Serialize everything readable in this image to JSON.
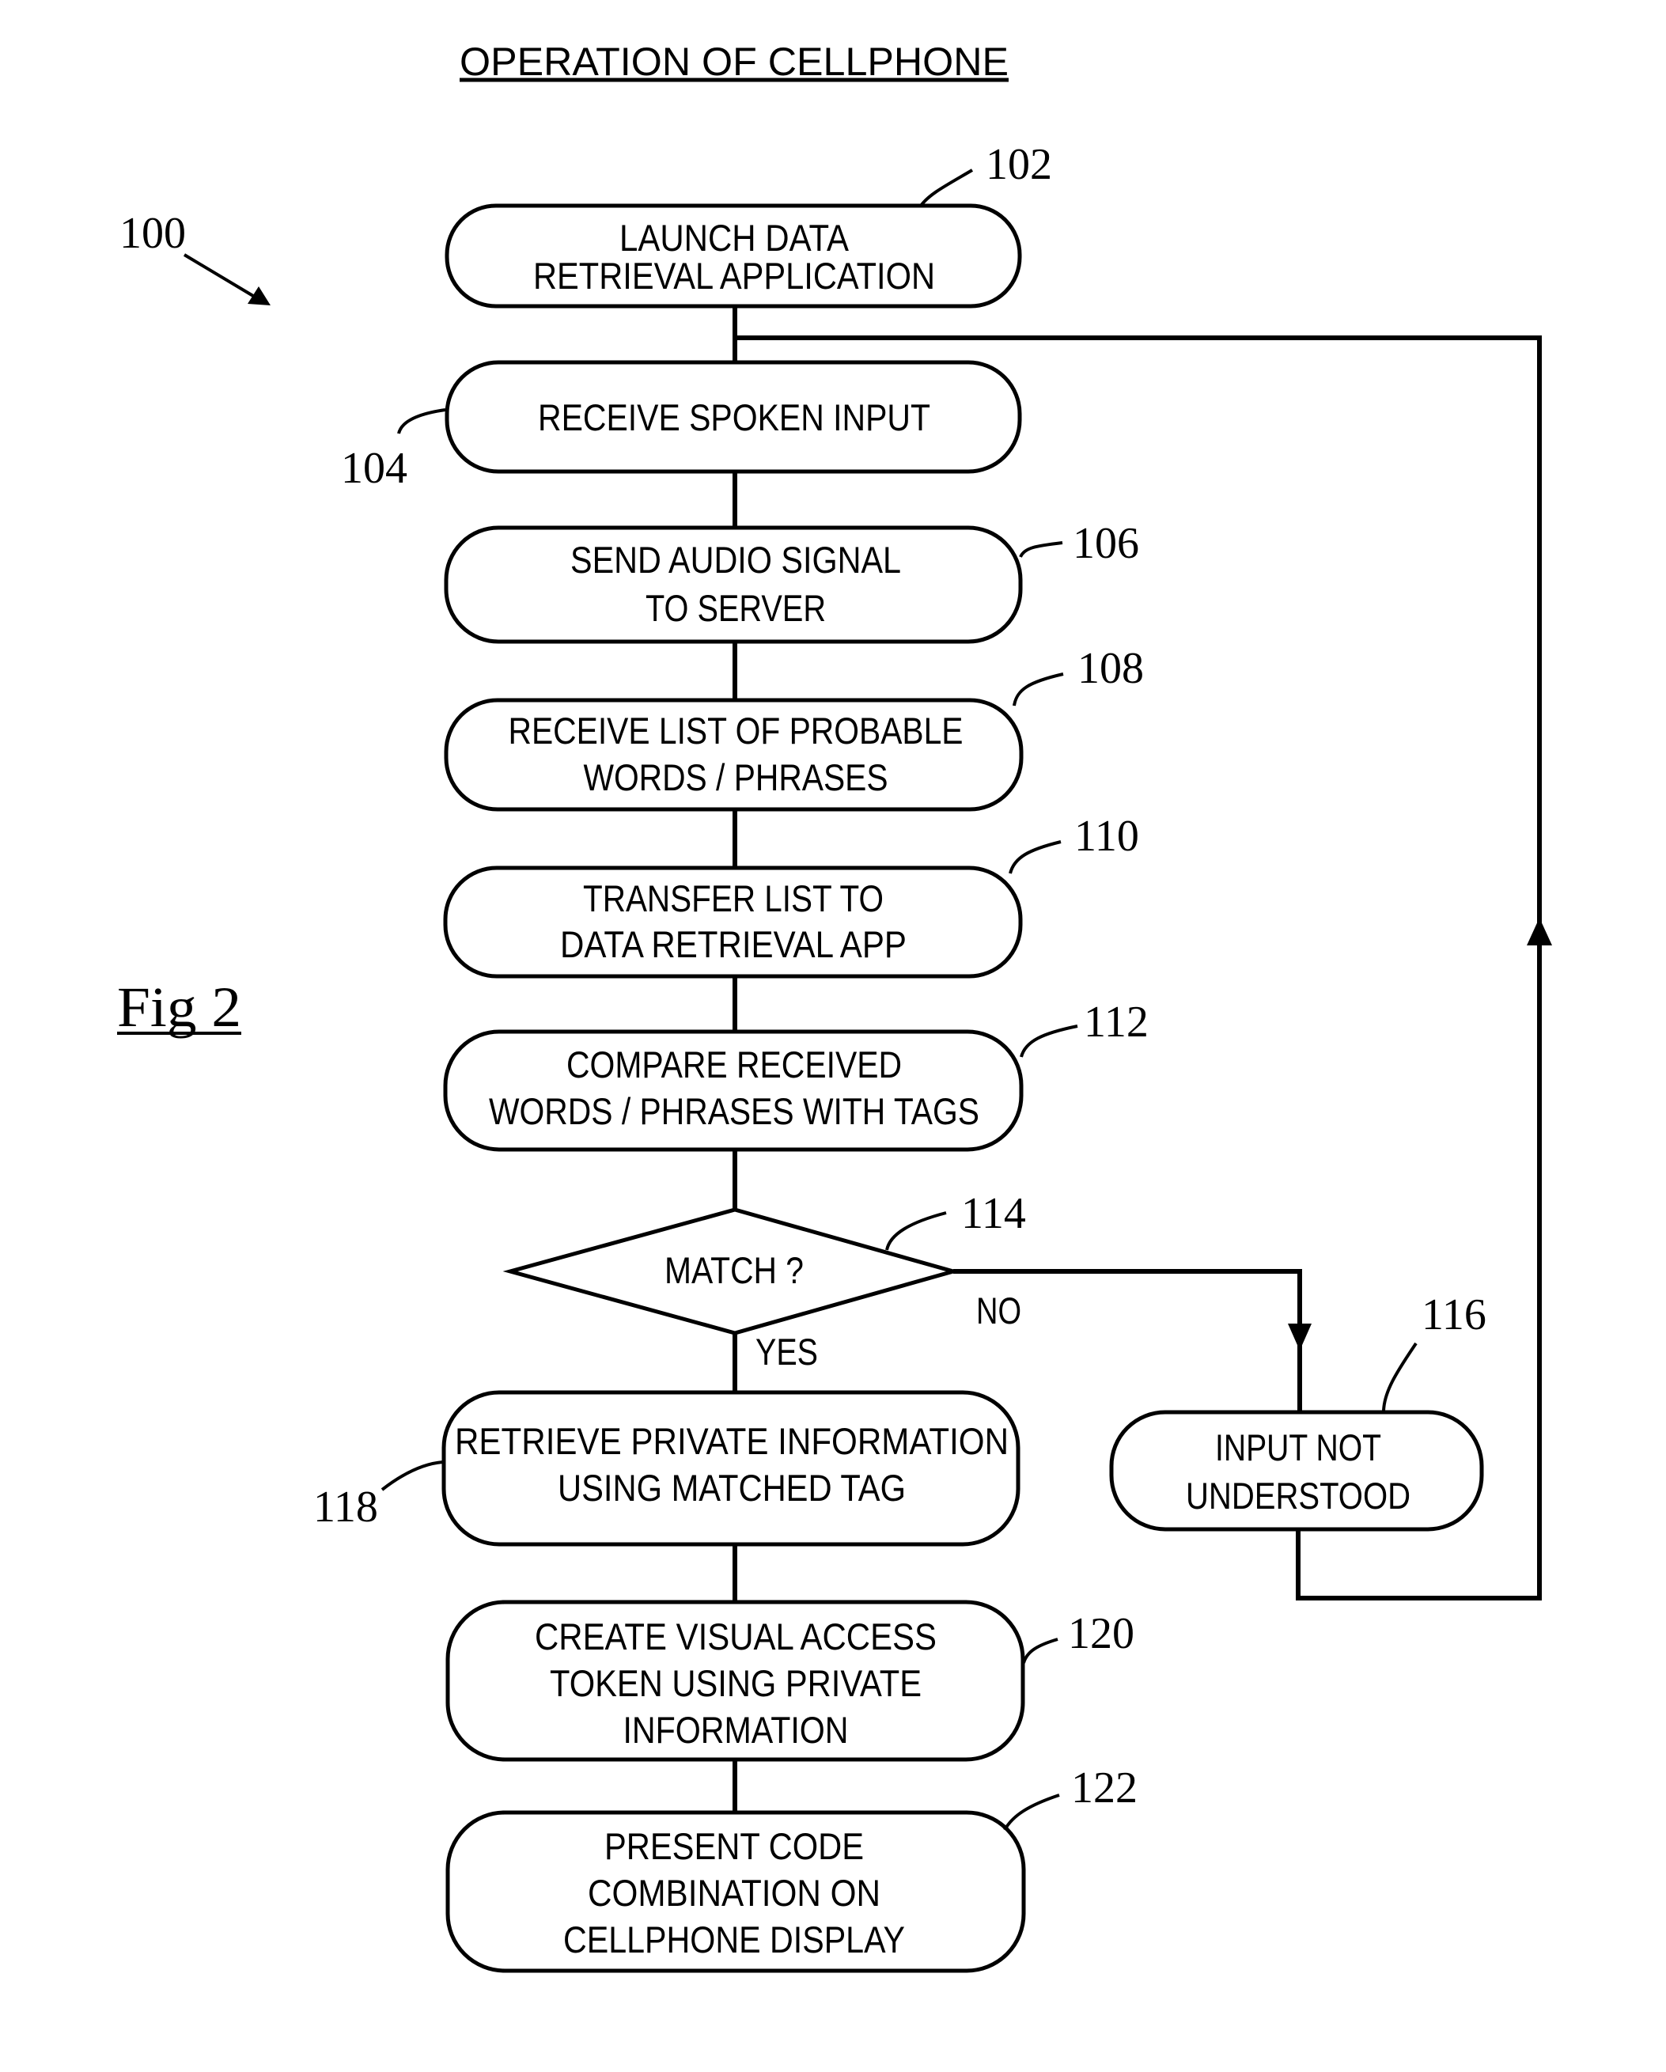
{
  "title": "OPERATION OF CELLPHONE",
  "figure_label": "Fig 2",
  "diagram_ref": "100",
  "steps": [
    {
      "id": "102",
      "type": "process",
      "lines": [
        "LAUNCH DATA",
        "RETRIEVAL APPLICATION"
      ]
    },
    {
      "id": "104",
      "type": "process",
      "lines": [
        "RECEIVE SPOKEN INPUT"
      ]
    },
    {
      "id": "106",
      "type": "process",
      "lines": [
        "SEND AUDIO SIGNAL",
        "TO SERVER"
      ]
    },
    {
      "id": "108",
      "type": "process",
      "lines": [
        "RECEIVE LIST OF PROBABLE",
        "WORDS / PHRASES"
      ]
    },
    {
      "id": "110",
      "type": "process",
      "lines": [
        "TRANSFER LIST TO",
        "DATA RETRIEVAL APP"
      ]
    },
    {
      "id": "112",
      "type": "process",
      "lines": [
        "COMPARE RECEIVED",
        "WORDS / PHRASES WITH TAGS"
      ]
    },
    {
      "id": "114",
      "type": "decision",
      "lines": [
        "MATCH ?"
      ]
    },
    {
      "id": "116",
      "type": "process",
      "lines": [
        "INPUT NOT",
        "UNDERSTOOD"
      ]
    },
    {
      "id": "118",
      "type": "process",
      "lines": [
        "RETRIEVE PRIVATE INFORMATION",
        "USING MATCHED TAG"
      ]
    },
    {
      "id": "120",
      "type": "process",
      "lines": [
        "CREATE VISUAL ACCESS",
        "TOKEN USING PRIVATE",
        "INFORMATION"
      ]
    },
    {
      "id": "122",
      "type": "process",
      "lines": [
        "PRESENT CODE",
        "COMBINATION ON",
        "CELLPHONE DISPLAY"
      ]
    }
  ],
  "branches": {
    "yes": "YES",
    "no": "NO"
  },
  "connections": [
    {
      "from": "102",
      "to": "104"
    },
    {
      "from": "104",
      "to": "106"
    },
    {
      "from": "106",
      "to": "108"
    },
    {
      "from": "108",
      "to": "110"
    },
    {
      "from": "110",
      "to": "112"
    },
    {
      "from": "112",
      "to": "114"
    },
    {
      "from": "114",
      "to": "118",
      "label": "YES"
    },
    {
      "from": "114",
      "to": "116",
      "label": "NO"
    },
    {
      "from": "116",
      "to": "104",
      "note": "loop back"
    },
    {
      "from": "118",
      "to": "120"
    },
    {
      "from": "120",
      "to": "122"
    }
  ]
}
